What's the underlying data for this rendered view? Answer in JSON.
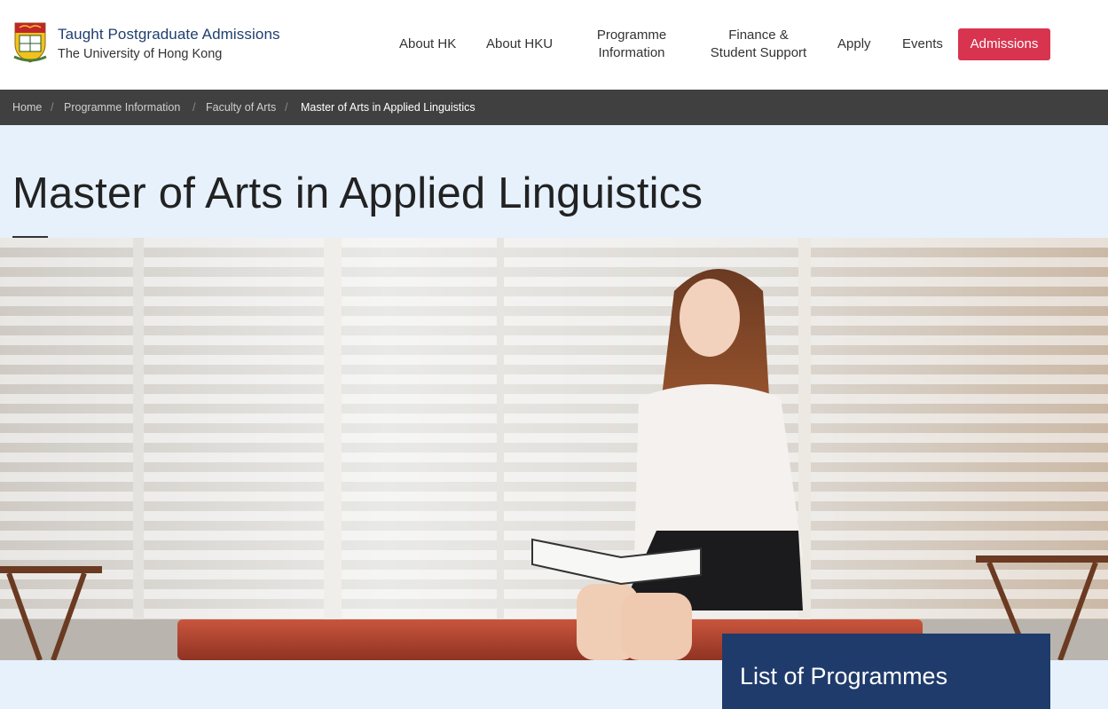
{
  "header": {
    "brand_title": "Taught Postgraduate Admissions",
    "brand_subtitle": "The University of Hong Kong",
    "crest_icon": "hku-crest-icon"
  },
  "nav": {
    "about_hk": "About HK",
    "about_hku": "About HKU",
    "programme_information": "Programme Information",
    "finance_student_support": "Finance & Student Support",
    "apply": "Apply",
    "events": "Events",
    "admissions": "Admissions"
  },
  "breadcrumb": {
    "items": [
      "Home",
      "Programme Information",
      "Faculty of Arts",
      "Master of Arts in Applied Linguistics"
    ],
    "separator": "/"
  },
  "page": {
    "title": "Master of Arts in Applied Linguistics"
  },
  "sidebar_panel": {
    "title": "List of Programmes"
  },
  "colors": {
    "brand_navy": "#1f3f6e",
    "admissions_red": "#d8344f",
    "breadcrumb_bg": "#404040",
    "page_bg": "#e6f1fc",
    "panel_navy": "#1f3b6b"
  }
}
